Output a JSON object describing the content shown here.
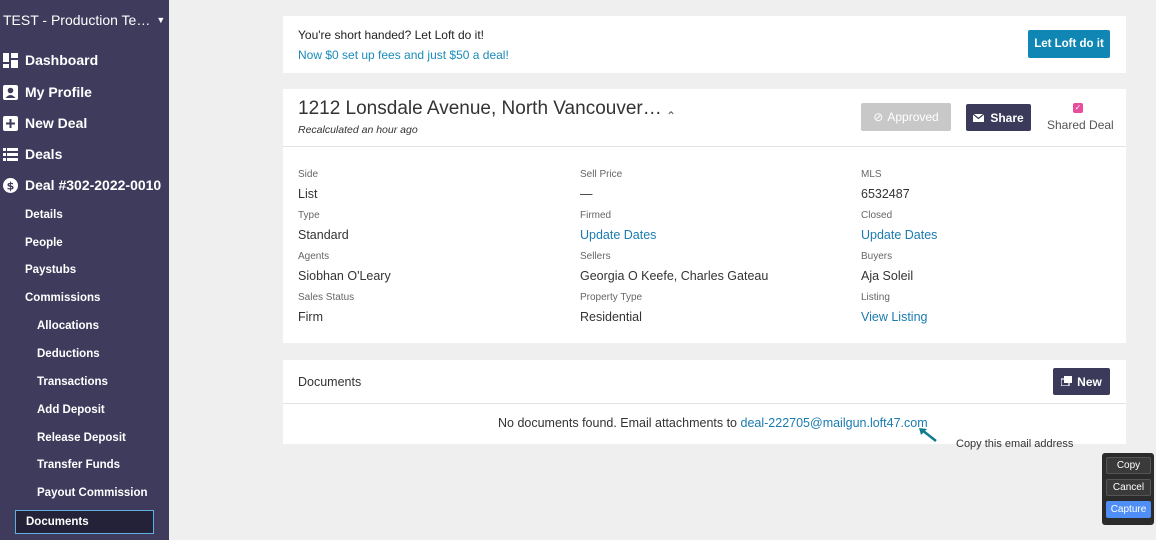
{
  "sidebar": {
    "org": "TEST - Production Te…",
    "main": [
      {
        "label": "Dashboard",
        "icon": "dashboard-icon"
      },
      {
        "label": "My Profile",
        "icon": "profile-icon"
      },
      {
        "label": "New Deal",
        "icon": "plus-icon"
      },
      {
        "label": "Deals",
        "icon": "list-icon"
      },
      {
        "label": "Deal #302-2022-0010",
        "icon": "dollar-icon"
      }
    ],
    "sub": [
      "Details",
      "People",
      "Paystubs",
      "Commissions"
    ],
    "subsub": [
      "Allocations",
      "Deductions",
      "Transactions",
      "Add Deposit",
      "Release Deposit",
      "Transfer Funds",
      "Payout Commission"
    ],
    "active": "Documents"
  },
  "promo": {
    "line1": "You're short handed? Let Loft do it!",
    "line2": "Now $0 set up fees and just $50 a deal!",
    "button": "Let Loft do it"
  },
  "deal": {
    "title": "1212 Lonsdale Avenue, North Vancouver…",
    "subtitle": "Recalculated an hour ago",
    "approved": "Approved",
    "share": "Share",
    "shared_label": "Shared Deal",
    "fields": {
      "side": {
        "label": "Side",
        "value": "List"
      },
      "sell_price": {
        "label": "Sell Price",
        "value": "—"
      },
      "mls": {
        "label": "MLS",
        "value": "6532487"
      },
      "type": {
        "label": "Type",
        "value": "Standard"
      },
      "firmed": {
        "label": "Firmed",
        "value": "Update Dates"
      },
      "closed": {
        "label": "Closed",
        "value": "Update Dates"
      },
      "agents": {
        "label": "Agents",
        "value": "Siobhan O'Leary"
      },
      "sellers": {
        "label": "Sellers",
        "value": "Georgia O Keefe, Charles Gateau"
      },
      "buyers": {
        "label": "Buyers",
        "value": "Aja Soleil"
      },
      "sales_status": {
        "label": "Sales Status",
        "value": "Firm"
      },
      "property_type": {
        "label": "Property Type",
        "value": "Residential"
      },
      "listing": {
        "label": "Listing",
        "value": "View Listing"
      }
    }
  },
  "documents": {
    "title": "Documents",
    "new": "New",
    "empty_prefix": "No documents found. Email attachments to ",
    "email": "deal-222705@mailgun.loft47.com"
  },
  "hint": "Copy this email address",
  "capture": {
    "copy": "Copy",
    "cancel": "Cancel",
    "capture": "Capture"
  },
  "colors": {
    "sidebar": "#3e3b5c",
    "accent": "#0f86b3",
    "dark_button": "#3b3a5a",
    "link": "#1a7bb0",
    "shared_check": "#e84c9c"
  }
}
